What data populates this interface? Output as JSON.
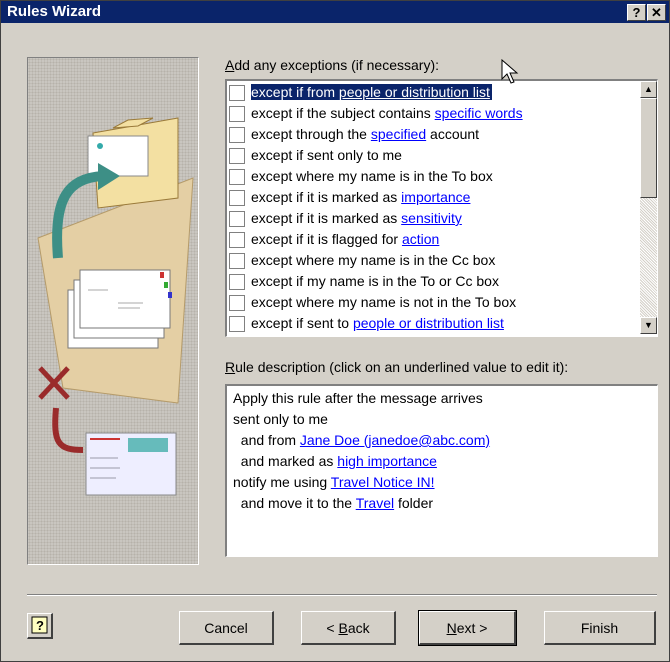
{
  "window": {
    "title": "Rules Wizard",
    "help_button": "?",
    "close_button": "✕"
  },
  "exceptions": {
    "label_prefix": "A",
    "label_rest": "dd any exceptions (if necessary):",
    "items": [
      {
        "before": "except if from ",
        "link": "people or distribution list",
        "after": "",
        "selected": true
      },
      {
        "before": "except if the subject contains ",
        "link": "specific words",
        "after": "",
        "selected": false
      },
      {
        "before": "except through the ",
        "link": "specified",
        "after": " account",
        "selected": false
      },
      {
        "before": "except if sent only to me",
        "link": "",
        "after": "",
        "selected": false
      },
      {
        "before": "except where my name is in the To box",
        "link": "",
        "after": "",
        "selected": false
      },
      {
        "before": "except if it is marked as ",
        "link": "importance",
        "after": "",
        "selected": false
      },
      {
        "before": "except if it is marked as ",
        "link": "sensitivity",
        "after": "",
        "selected": false
      },
      {
        "before": "except if it is flagged for ",
        "link": "action",
        "after": "",
        "selected": false
      },
      {
        "before": "except where my name is in the Cc box",
        "link": "",
        "after": "",
        "selected": false
      },
      {
        "before": "except if my name is in the To or Cc box",
        "link": "",
        "after": "",
        "selected": false
      },
      {
        "before": "except where my name is not in the To box",
        "link": "",
        "after": "",
        "selected": false
      },
      {
        "before": "except if sent to ",
        "link": "people or distribution list",
        "after": "",
        "selected": false
      }
    ]
  },
  "description": {
    "label_prefix": "R",
    "label_rest": "ule description (click on an underlined value to edit it):",
    "lines": [
      {
        "before": "Apply this rule after the message arrives",
        "link": "",
        "after": ""
      },
      {
        "before": "sent only to me",
        "link": "",
        "after": ""
      },
      {
        "before": "  and from ",
        "link": "Jane Doe (janedoe@abc.com)",
        "after": ""
      },
      {
        "before": "  and marked as ",
        "link": "high importance",
        "after": ""
      },
      {
        "before": "notify me using ",
        "link": "Travel Notice IN!",
        "after": ""
      },
      {
        "before": "  and move it to the ",
        "link": "Travel",
        "after": " folder"
      }
    ]
  },
  "buttons": {
    "cancel": "Cancel",
    "back_prefix": "< ",
    "back_key": "B",
    "back_rest": "ack",
    "next_key": "N",
    "next_rest": "ext >",
    "finish": "Finish",
    "help_icon": "?"
  },
  "colors": {
    "titlebar": "#0a246a",
    "selection": "#0a246a",
    "link": "#0000ff",
    "face": "#d4d0c8"
  }
}
